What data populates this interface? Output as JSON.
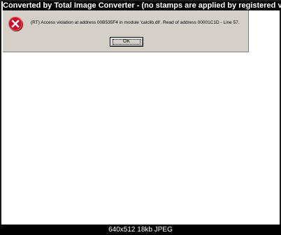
{
  "watermark": "Converted by Total Image Converter - (no stamps are applied by registered version)",
  "dialog": {
    "icon": "error-icon",
    "message": "(RT) Access violation at address 00B535F4 in module 'calclib.dll'. Read of address 00001C1D - Line 57.",
    "ok_label": "OK"
  },
  "info_bar": {
    "text": "640x512  18kb JPEG"
  },
  "colors": {
    "dialog_bg": "#d4d0c8",
    "error_red": "#c8102e",
    "bar_bg": "#000000",
    "bar_text": "#ffffff"
  }
}
